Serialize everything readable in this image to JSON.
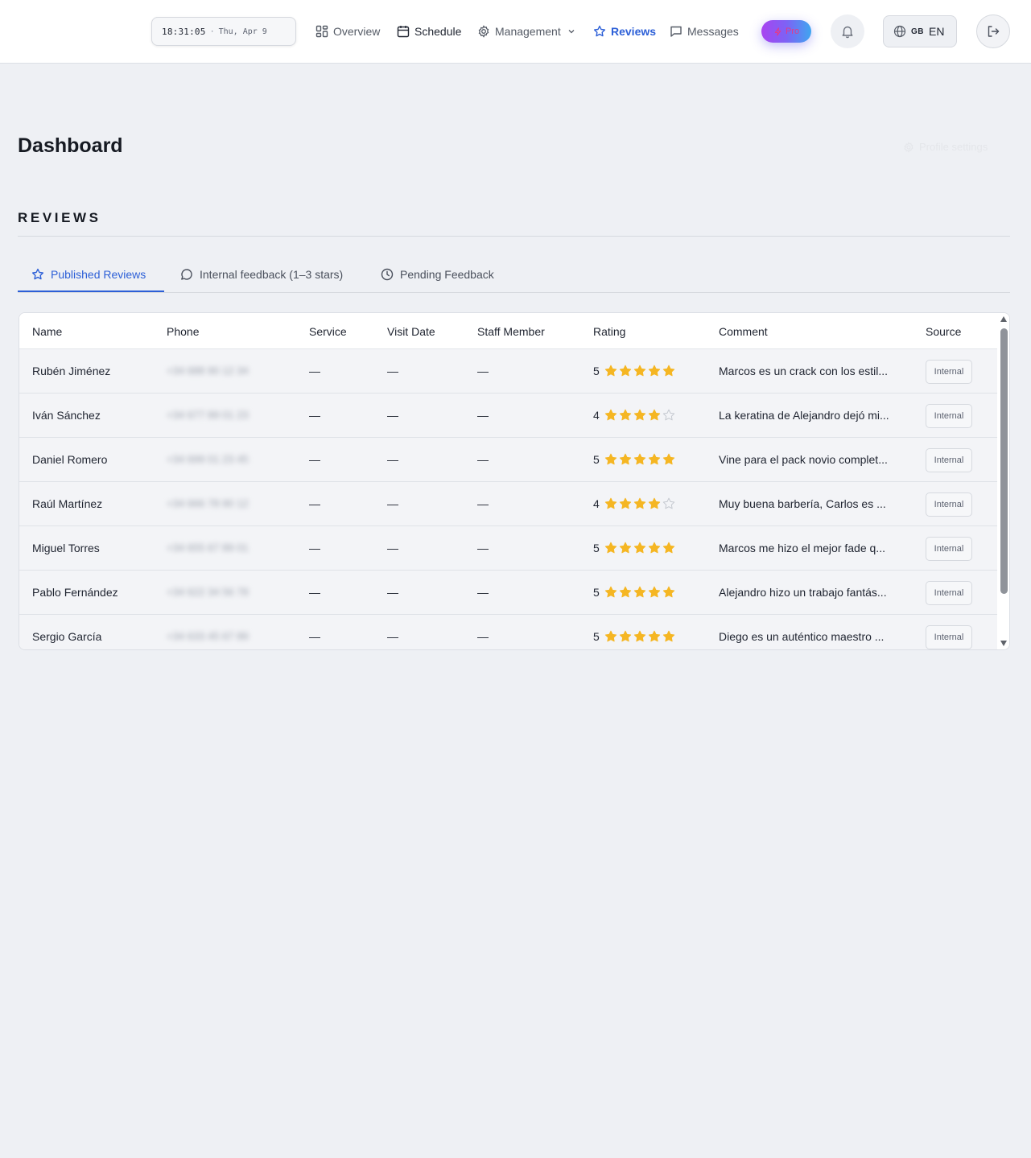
{
  "header": {
    "clock": {
      "time": "18:31:05",
      "separator": "·",
      "date": "Thu, Apr 9"
    },
    "nav": [
      {
        "label": "Overview",
        "icon": "grid-icon"
      },
      {
        "label": "Schedule",
        "icon": "calendar-icon"
      },
      {
        "label": "Management",
        "icon": "gear-icon"
      },
      {
        "label": "Reviews",
        "icon": "star-icon",
        "active": true
      },
      {
        "label": "Messages",
        "icon": "message-icon"
      }
    ],
    "pro_label": "Pro",
    "language": {
      "flag": "GB",
      "code": "EN"
    }
  },
  "page": {
    "title": "Dashboard",
    "profile_settings": "Profile settings",
    "section_title": "REVIEWS"
  },
  "tabs": [
    {
      "label": "Published Reviews",
      "icon": "star-icon",
      "active": true
    },
    {
      "label": "Internal feedback (1–3 stars)",
      "icon": "chat-bubble-icon"
    },
    {
      "label": "Pending Feedback",
      "icon": "clock-icon"
    }
  ],
  "table": {
    "columns": [
      "Name",
      "Phone",
      "Service",
      "Visit Date",
      "Staff Member",
      "Rating",
      "Comment",
      "Source"
    ],
    "rows": [
      {
        "name": "Rubén Jiménez",
        "phone": "+34 688 90 12 34",
        "service": "—",
        "visit_date": "—",
        "staff": "—",
        "rating": 5,
        "rating_label": "5",
        "comment": "Marcos es un crack con los estil...",
        "source": "Internal"
      },
      {
        "name": "Iván Sánchez",
        "phone": "+34 677 89 01 23",
        "service": "—",
        "visit_date": "—",
        "staff": "—",
        "rating": 4,
        "rating_label": "4",
        "comment": "La keratina de Alejandro dejó mi...",
        "source": "Internal"
      },
      {
        "name": "Daniel Romero",
        "phone": "+34 699 01 23 45",
        "service": "—",
        "visit_date": "—",
        "staff": "—",
        "rating": 5,
        "rating_label": "5",
        "comment": "Vine para el pack novio complet...",
        "source": "Internal"
      },
      {
        "name": "Raúl Martínez",
        "phone": "+34 666 78 90 12",
        "service": "—",
        "visit_date": "—",
        "staff": "—",
        "rating": 4,
        "rating_label": "4",
        "comment": "Muy buena barbería, Carlos es ...",
        "source": "Internal"
      },
      {
        "name": "Miguel Torres",
        "phone": "+34 655 67 89 01",
        "service": "—",
        "visit_date": "—",
        "staff": "—",
        "rating": 5,
        "rating_label": "5",
        "comment": "Marcos me hizo el mejor fade q...",
        "source": "Internal"
      },
      {
        "name": "Pablo Fernández",
        "phone": "+34 622 34 56 78",
        "service": "—",
        "visit_date": "—",
        "staff": "—",
        "rating": 5,
        "rating_label": "5",
        "comment": "Alejandro hizo un trabajo fantás...",
        "source": "Internal"
      },
      {
        "name": "Sergio García",
        "phone": "+34 633 45 67 89",
        "service": "—",
        "visit_date": "—",
        "staff": "—",
        "rating": 5,
        "rating_label": "5",
        "comment": "Diego es un auténtico maestro ...",
        "source": "Internal"
      }
    ]
  },
  "colors": {
    "accent": "#2c5fd7",
    "star_filled": "#f5b623",
    "star_empty": "#c4c8cf",
    "page_bg": "#eef0f4"
  }
}
